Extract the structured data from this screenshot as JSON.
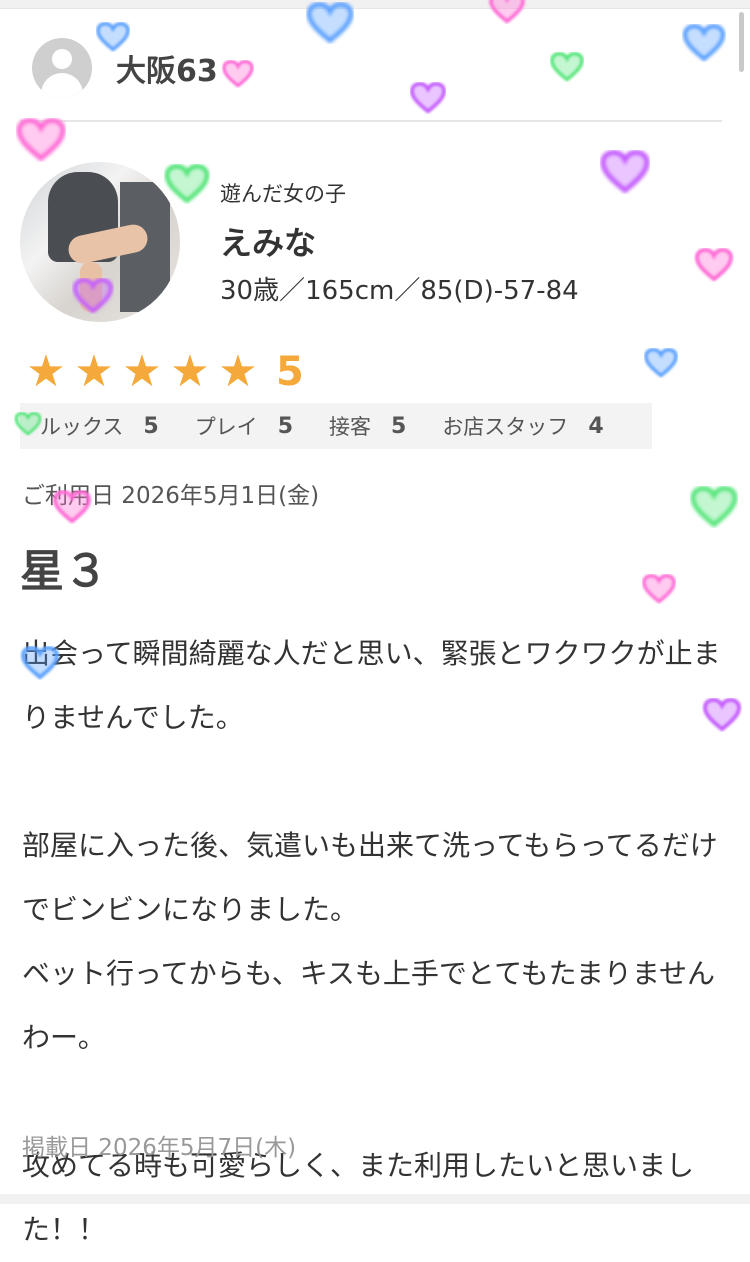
{
  "reviewer": {
    "name": "大阪63"
  },
  "girl": {
    "label": "遊んだ女の子",
    "name": "えみな",
    "stats": "30歳／165cm／85(D)-57-84"
  },
  "rating": {
    "overall": "5",
    "star_count": 5,
    "scores": [
      {
        "label": "ルックス",
        "value": "5"
      },
      {
        "label": "プレイ",
        "value": "5"
      },
      {
        "label": "接客",
        "value": "5"
      },
      {
        "label": "お店スタッフ",
        "value": "4"
      }
    ]
  },
  "review": {
    "use_date": "ご利用日 2026年5月1日(金)",
    "title": "星３",
    "body": "出会って瞬間綺麗な人だと思い、緊張とワクワクが止まりませんでした。\n\n部屋に入った後、気遣いも出来て洗ってもらってるだけでビンビンになりました。\nベット行ってからも、キスも上手でとてもたまりませんわー。\n\n攻めてる時も可愛らしく、また利用したいと思いました！！",
    "post_date": "掲載日 2026年5月7日(木)"
  },
  "colors": {
    "star": "#f5a93b",
    "heart_pink": "#ff6ad5",
    "heart_purple": "#c45cff",
    "heart_blue": "#5aa0ff",
    "heart_green": "#55e57a"
  }
}
